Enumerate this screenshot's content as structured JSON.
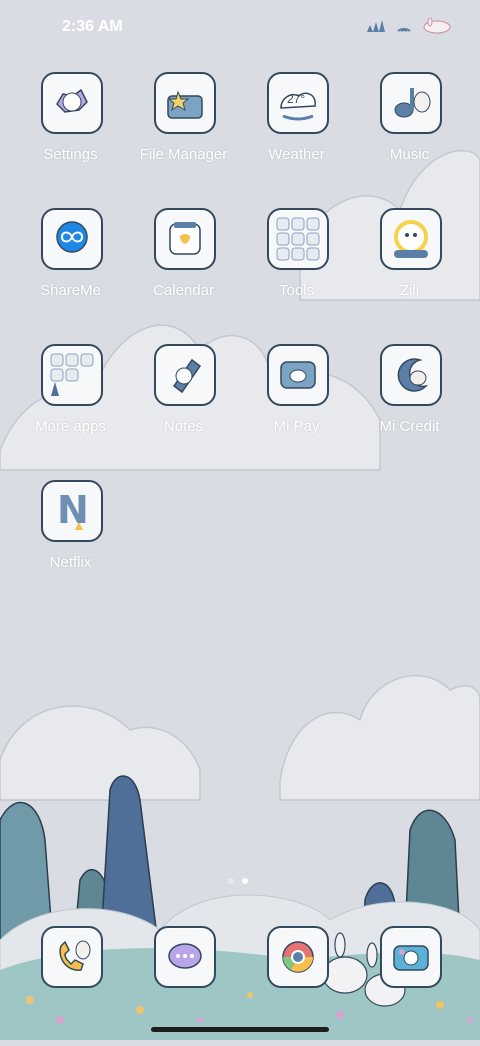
{
  "status_bar": {
    "time": "2:36 AM",
    "icons": [
      "signal-icon",
      "wifi-icon",
      "battery-icon"
    ]
  },
  "apps": [
    {
      "label": "Settings",
      "icon": "settings-icon"
    },
    {
      "label": "File Manager",
      "icon": "folder-icon"
    },
    {
      "label": "Weather",
      "icon": "weather-icon",
      "badge": "27°"
    },
    {
      "label": "Music",
      "icon": "music-icon"
    },
    {
      "label": "ShareMe",
      "icon": "shareme-icon"
    },
    {
      "label": "Calendar",
      "icon": "calendar-icon"
    },
    {
      "label": "Tools",
      "icon": "tools-folder-icon"
    },
    {
      "label": "Zili",
      "icon": "zili-icon"
    },
    {
      "label": "More apps",
      "icon": "more-apps-folder-icon"
    },
    {
      "label": "Notes",
      "icon": "notes-icon"
    },
    {
      "label": "Mi Pay",
      "icon": "wallet-icon"
    },
    {
      "label": "Mi Credit",
      "icon": "credit-icon"
    },
    {
      "label": "Netflix",
      "icon": "netflix-icon",
      "badge": "N"
    }
  ],
  "dock": [
    {
      "icon": "phone-icon"
    },
    {
      "icon": "messages-icon"
    },
    {
      "icon": "chrome-icon"
    },
    {
      "icon": "camera-icon"
    }
  ],
  "page_indicator": {
    "pages": 2,
    "active": 2
  },
  "colors": {
    "accent": "#5b7fa6",
    "tile_border": "#34495e",
    "sky": "#d9dde3"
  }
}
